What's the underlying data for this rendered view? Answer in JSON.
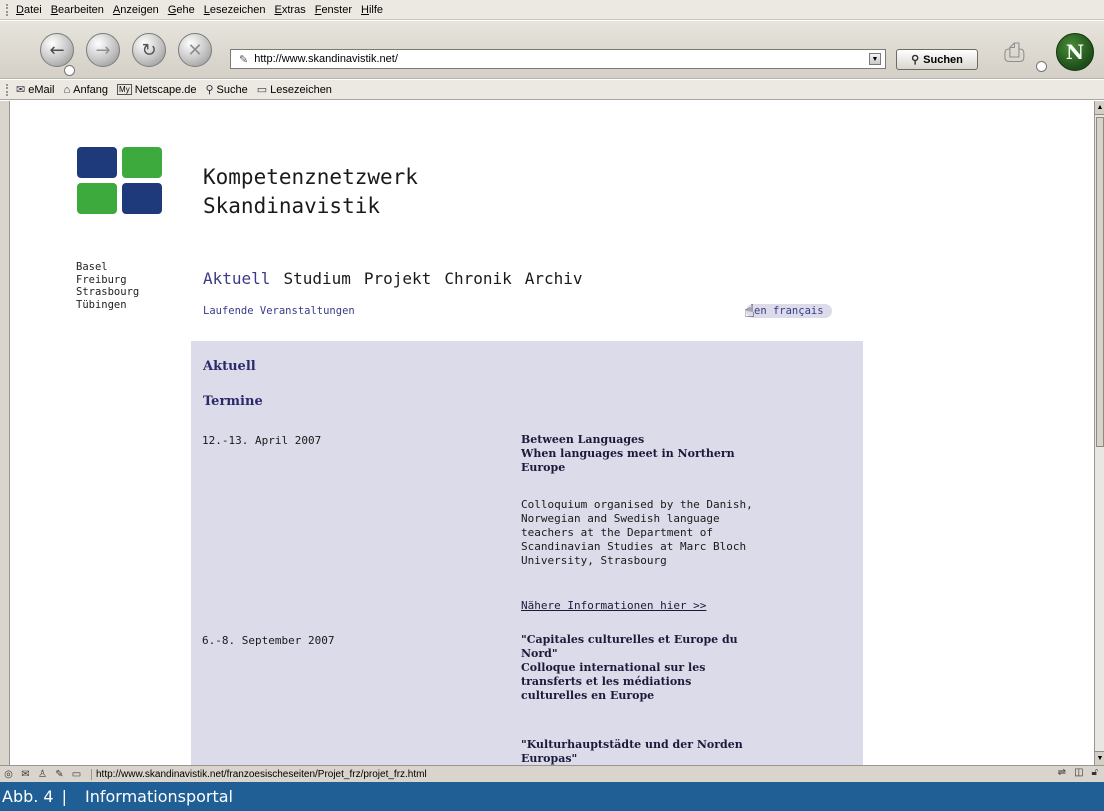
{
  "browser": {
    "menu": [
      "Datei",
      "Bearbeiten",
      "Anzeigen",
      "Gehe",
      "Lesezeichen",
      "Extras",
      "Fenster",
      "Hilfe"
    ],
    "url": "http://www.skandinavistik.net/",
    "search_label": "Suchen",
    "personal_toolbar": [
      "eMail",
      "Anfang",
      "Netscape.de",
      "Suche",
      "Lesezeichen"
    ],
    "status_url": "http://www.skandinavistik.net/franzoesischeseiten/Projet_frz/projet_frz.html"
  },
  "site": {
    "title_line1": "Kompetenznetzwerk",
    "title_line2": "Skandinavistik",
    "cities": [
      "Basel",
      "Freiburg",
      "Strasbourg",
      "Tübingen"
    ],
    "nav": [
      "Aktuell",
      "Studium",
      "Projekt",
      "Chronik",
      "Archiv"
    ],
    "subnav": "Laufende Veranstaltungen",
    "language_link": "en français",
    "logo_colors": {
      "blue": "#1f3a7a",
      "green": "#3daa3d"
    },
    "panel_color": "#dcdbe9"
  },
  "content": {
    "heading": "Aktuell",
    "subheading": "Termine",
    "events": [
      {
        "date": "12.-13. April 2007",
        "title_lines": [
          "Between Languages",
          "When languages meet in Northern",
          "Europe"
        ],
        "description_lines": [
          "Colloquium organised by the Danish,",
          "Norwegian and Swedish language",
          "teachers at the Department of",
          "Scandinavian Studies at Marc Bloch",
          "University, Strasbourg"
        ],
        "link": "Nähere Informationen hier >>"
      },
      {
        "date": "6.-8. September 2007",
        "title_lines": [
          "\"Capitales culturelles et Europe du",
          "Nord\"",
          "Colloque international sur les",
          "transferts et les médiations",
          "culturelles en Europe"
        ],
        "title2_lines": [
          "\"Kulturhauptstädte und der Norden",
          "Europas\""
        ]
      }
    ]
  },
  "caption": {
    "label": "Abb. 4",
    "separator": "|",
    "text": "Informationsportal"
  }
}
